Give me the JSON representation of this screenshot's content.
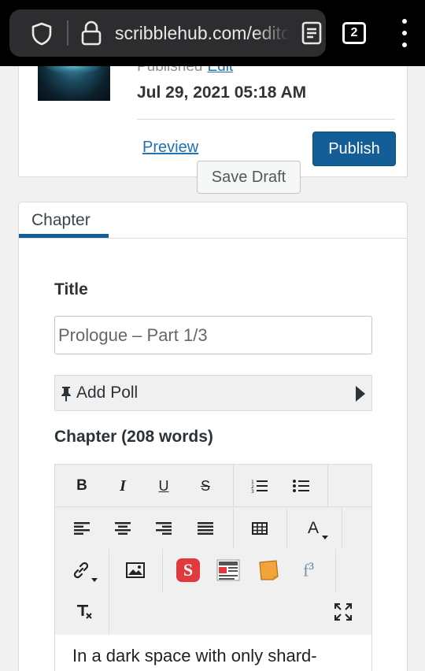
{
  "browser": {
    "url": "scribblehub.com/editor",
    "tab_count": "2"
  },
  "publish": {
    "published_label": "Published",
    "edit_label": "Edit",
    "date": "Jul 29, 2021 05:18 AM",
    "preview_label": "Preview",
    "publish_label": "Publish",
    "save_draft_label": "Save Draft"
  },
  "chapter": {
    "tab_label": "Chapter",
    "title_label": "Title",
    "title_placeholder": "Prologue – Part 1/3",
    "add_poll_label": "Add Poll",
    "word_count_label": "Chapter (208 words)",
    "content_preview": "In a dark space with only shard-"
  },
  "toolbar": {
    "bold": "B",
    "italic": "I",
    "underline": "U",
    "strikethrough": "S",
    "font_color": "A",
    "plugin_s": "S",
    "plugin_f": "f",
    "plugin_f_sup": "3"
  },
  "colors": {
    "accent": "#135e96",
    "link": "#2271b1"
  }
}
